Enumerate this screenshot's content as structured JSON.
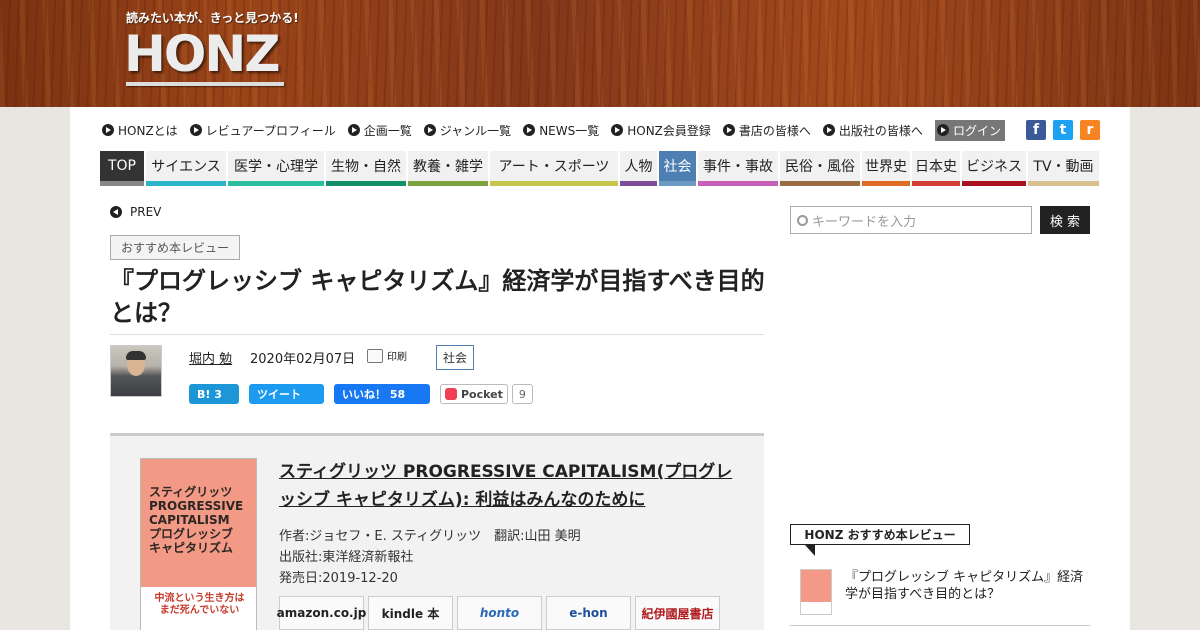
{
  "header": {
    "tagline": "読みたい本が、きっと見つかる!",
    "logo": "HONZ"
  },
  "topnav": [
    "HONZとは",
    "レビュアープロフィール",
    "企画一覧",
    "ジャンル一覧",
    "NEWS一覧",
    "HONZ会員登録",
    "書店の皆様へ",
    "出版社の皆様へ",
    "ログイン"
  ],
  "social": [
    {
      "icon": "facebook-icon",
      "glyph": "f",
      "color": "#3b5998"
    },
    {
      "icon": "twitter-icon",
      "glyph": "t",
      "color": "#1da1f2"
    },
    {
      "icon": "rss-icon",
      "glyph": "r",
      "color": "#f78422"
    }
  ],
  "categories": [
    {
      "label": "TOP",
      "color": "#888888"
    },
    {
      "label": "サイエンス",
      "color": "#2bb5cb"
    },
    {
      "label": "医学・心理学",
      "color": "#2bbfa0"
    },
    {
      "label": "生物・自然",
      "color": "#149069"
    },
    {
      "label": "教養・雑学",
      "color": "#7da33e"
    },
    {
      "label": "アート・スポーツ",
      "color": "#c5c54c"
    },
    {
      "label": "人物",
      "color": "#7f4c9a"
    },
    {
      "label": "社会",
      "color": "#6e99c5"
    },
    {
      "label": "事件・事故",
      "color": "#c75fb7"
    },
    {
      "label": "民俗・風俗",
      "color": "#9a6c3f"
    },
    {
      "label": "世界史",
      "color": "#e06b22"
    },
    {
      "label": "日本史",
      "color": "#d23e33"
    },
    {
      "label": "ビジネス",
      "color": "#a8121f"
    },
    {
      "label": "TV・動画",
      "color": "#d9c08f"
    }
  ],
  "article": {
    "prev": "PREV",
    "tag": "おすすめ本レビュー",
    "title": "『プログレッシブ キャピタリズム』経済学が目指すべき目的とは？",
    "author": "堀内 勉",
    "date": "2020年02月07日",
    "print": "印刷",
    "category": "社会"
  },
  "shares": {
    "hatena": "B! 3",
    "tweet": "ツイート",
    "like": "いいね！ 58",
    "pocket": "Pocket",
    "pocket_count": "9"
  },
  "book": {
    "title": "スティグリッツ PROGRESSIVE CAPITALISM(プログレッシブ キャピタリズム): 利益はみんなのために",
    "author_line": "作者:ジョセフ・E. スティグリッツ　翻訳:山田 美明",
    "publisher_line": "出版社:東洋経済新報社",
    "release_line": "発売日:2019-12-20",
    "cover_text": "スティグリッツ\nPROGRESSIVE\nCAPITALISM\nプログレッシブ\nキャピタリズム",
    "cover_band": "中流という生き方は\nまだ死んでいない",
    "stores": [
      "amazon.co.jp",
      "kindle 本",
      "honto",
      "e-hon",
      "紀伊國屋書店"
    ]
  },
  "sidebar": {
    "search_placeholder": "キーワードを入力",
    "search_button": "検 索",
    "section_head": "HONZ おすすめ本レビュー",
    "item_title": "『プログレッシブ キャピタリズム』経済学が目指すべき目的とは？"
  }
}
